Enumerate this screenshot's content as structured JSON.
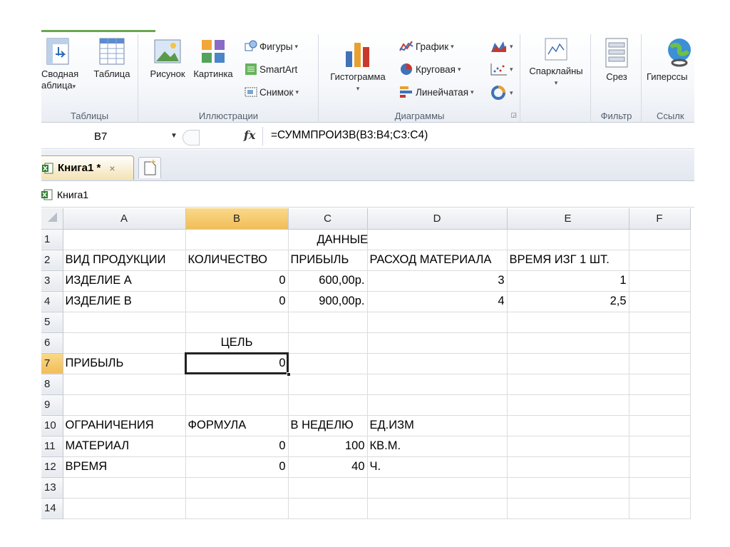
{
  "ribbon": {
    "groups": {
      "tables": {
        "label": "Таблицы",
        "pivot_line1": "Сводная",
        "pivot_line2": "аблица",
        "table": "Таблица"
      },
      "illustrations": {
        "label": "Иллюстрации",
        "picture": "Рисунок",
        "clipart": "Картинка",
        "shapes": "Фигуры",
        "smartart": "SmartArt",
        "screenshot": "Снимок"
      },
      "charts": {
        "label": "Диаграммы",
        "column": "Гистограмма",
        "line": "График",
        "pie": "Круговая",
        "bar": "Линейчатая"
      },
      "sparklines": {
        "label": "",
        "sparklines": "Спарклайны"
      },
      "filter": {
        "label": "Фильтр",
        "slicer": "Срез"
      },
      "links": {
        "label": "Ссылк",
        "hyperlink": "Гиперссы"
      }
    }
  },
  "formula_bar": {
    "name_box": "B7",
    "fx": "fx",
    "formula": "=СУММПРОИЗВ(B3:B4;C3:C4)"
  },
  "tabs": {
    "workbook_tab": "Книга1 *",
    "close": "×"
  },
  "window": {
    "title": "Книга1"
  },
  "grid": {
    "columns": [
      "A",
      "B",
      "C",
      "D",
      "E",
      "F"
    ],
    "selected_column": "B",
    "selected_row": "7",
    "rows": [
      {
        "n": "1",
        "a": "",
        "b": "",
        "c": "ДАННЫЕ",
        "d": "",
        "e": ""
      },
      {
        "n": "2",
        "a": "ВИД ПРОДУКЦИИ",
        "b": "КОЛИЧЕСТВО",
        "c": "ПРИБЫЛЬ",
        "d": "РАСХОД МАТЕРИАЛА",
        "e": "ВРЕМЯ ИЗГ 1 ШТ."
      },
      {
        "n": "3",
        "a": "ИЗДЕЛИЕ А",
        "b": "0",
        "c": "600,00р.",
        "d": "3",
        "e": "1"
      },
      {
        "n": "4",
        "a": "ИЗДЕЛИЕ В",
        "b": "0",
        "c": "900,00р.",
        "d": "4",
        "e": "2,5"
      },
      {
        "n": "5",
        "a": "",
        "b": "",
        "c": "",
        "d": "",
        "e": ""
      },
      {
        "n": "6",
        "a": "",
        "b": "ЦЕЛЬ",
        "c": "",
        "d": "",
        "e": ""
      },
      {
        "n": "7",
        "a": "ПРИБЫЛЬ",
        "b": "0",
        "c": "",
        "d": "",
        "e": ""
      },
      {
        "n": "8",
        "a": "",
        "b": "",
        "c": "",
        "d": "",
        "e": ""
      },
      {
        "n": "9",
        "a": "",
        "b": "",
        "c": "",
        "d": "",
        "e": ""
      },
      {
        "n": "10",
        "a": "ОГРАНИЧЕНИЯ",
        "b": "ФОРМУЛА",
        "c": "В НЕДЕЛЮ",
        "d": "ЕД.ИЗМ",
        "e": ""
      },
      {
        "n": "11",
        "a": "МАТЕРИАЛ",
        "b": "0",
        "c": "100",
        "d": "КВ.М.",
        "e": ""
      },
      {
        "n": "12",
        "a": "ВРЕМЯ",
        "b": "0",
        "c": "40",
        "d": "Ч.",
        "e": ""
      },
      {
        "n": "13",
        "a": "",
        "b": "",
        "c": "",
        "d": "",
        "e": ""
      },
      {
        "n": "14",
        "a": "",
        "b": "",
        "c": "",
        "d": "",
        "e": ""
      }
    ]
  }
}
